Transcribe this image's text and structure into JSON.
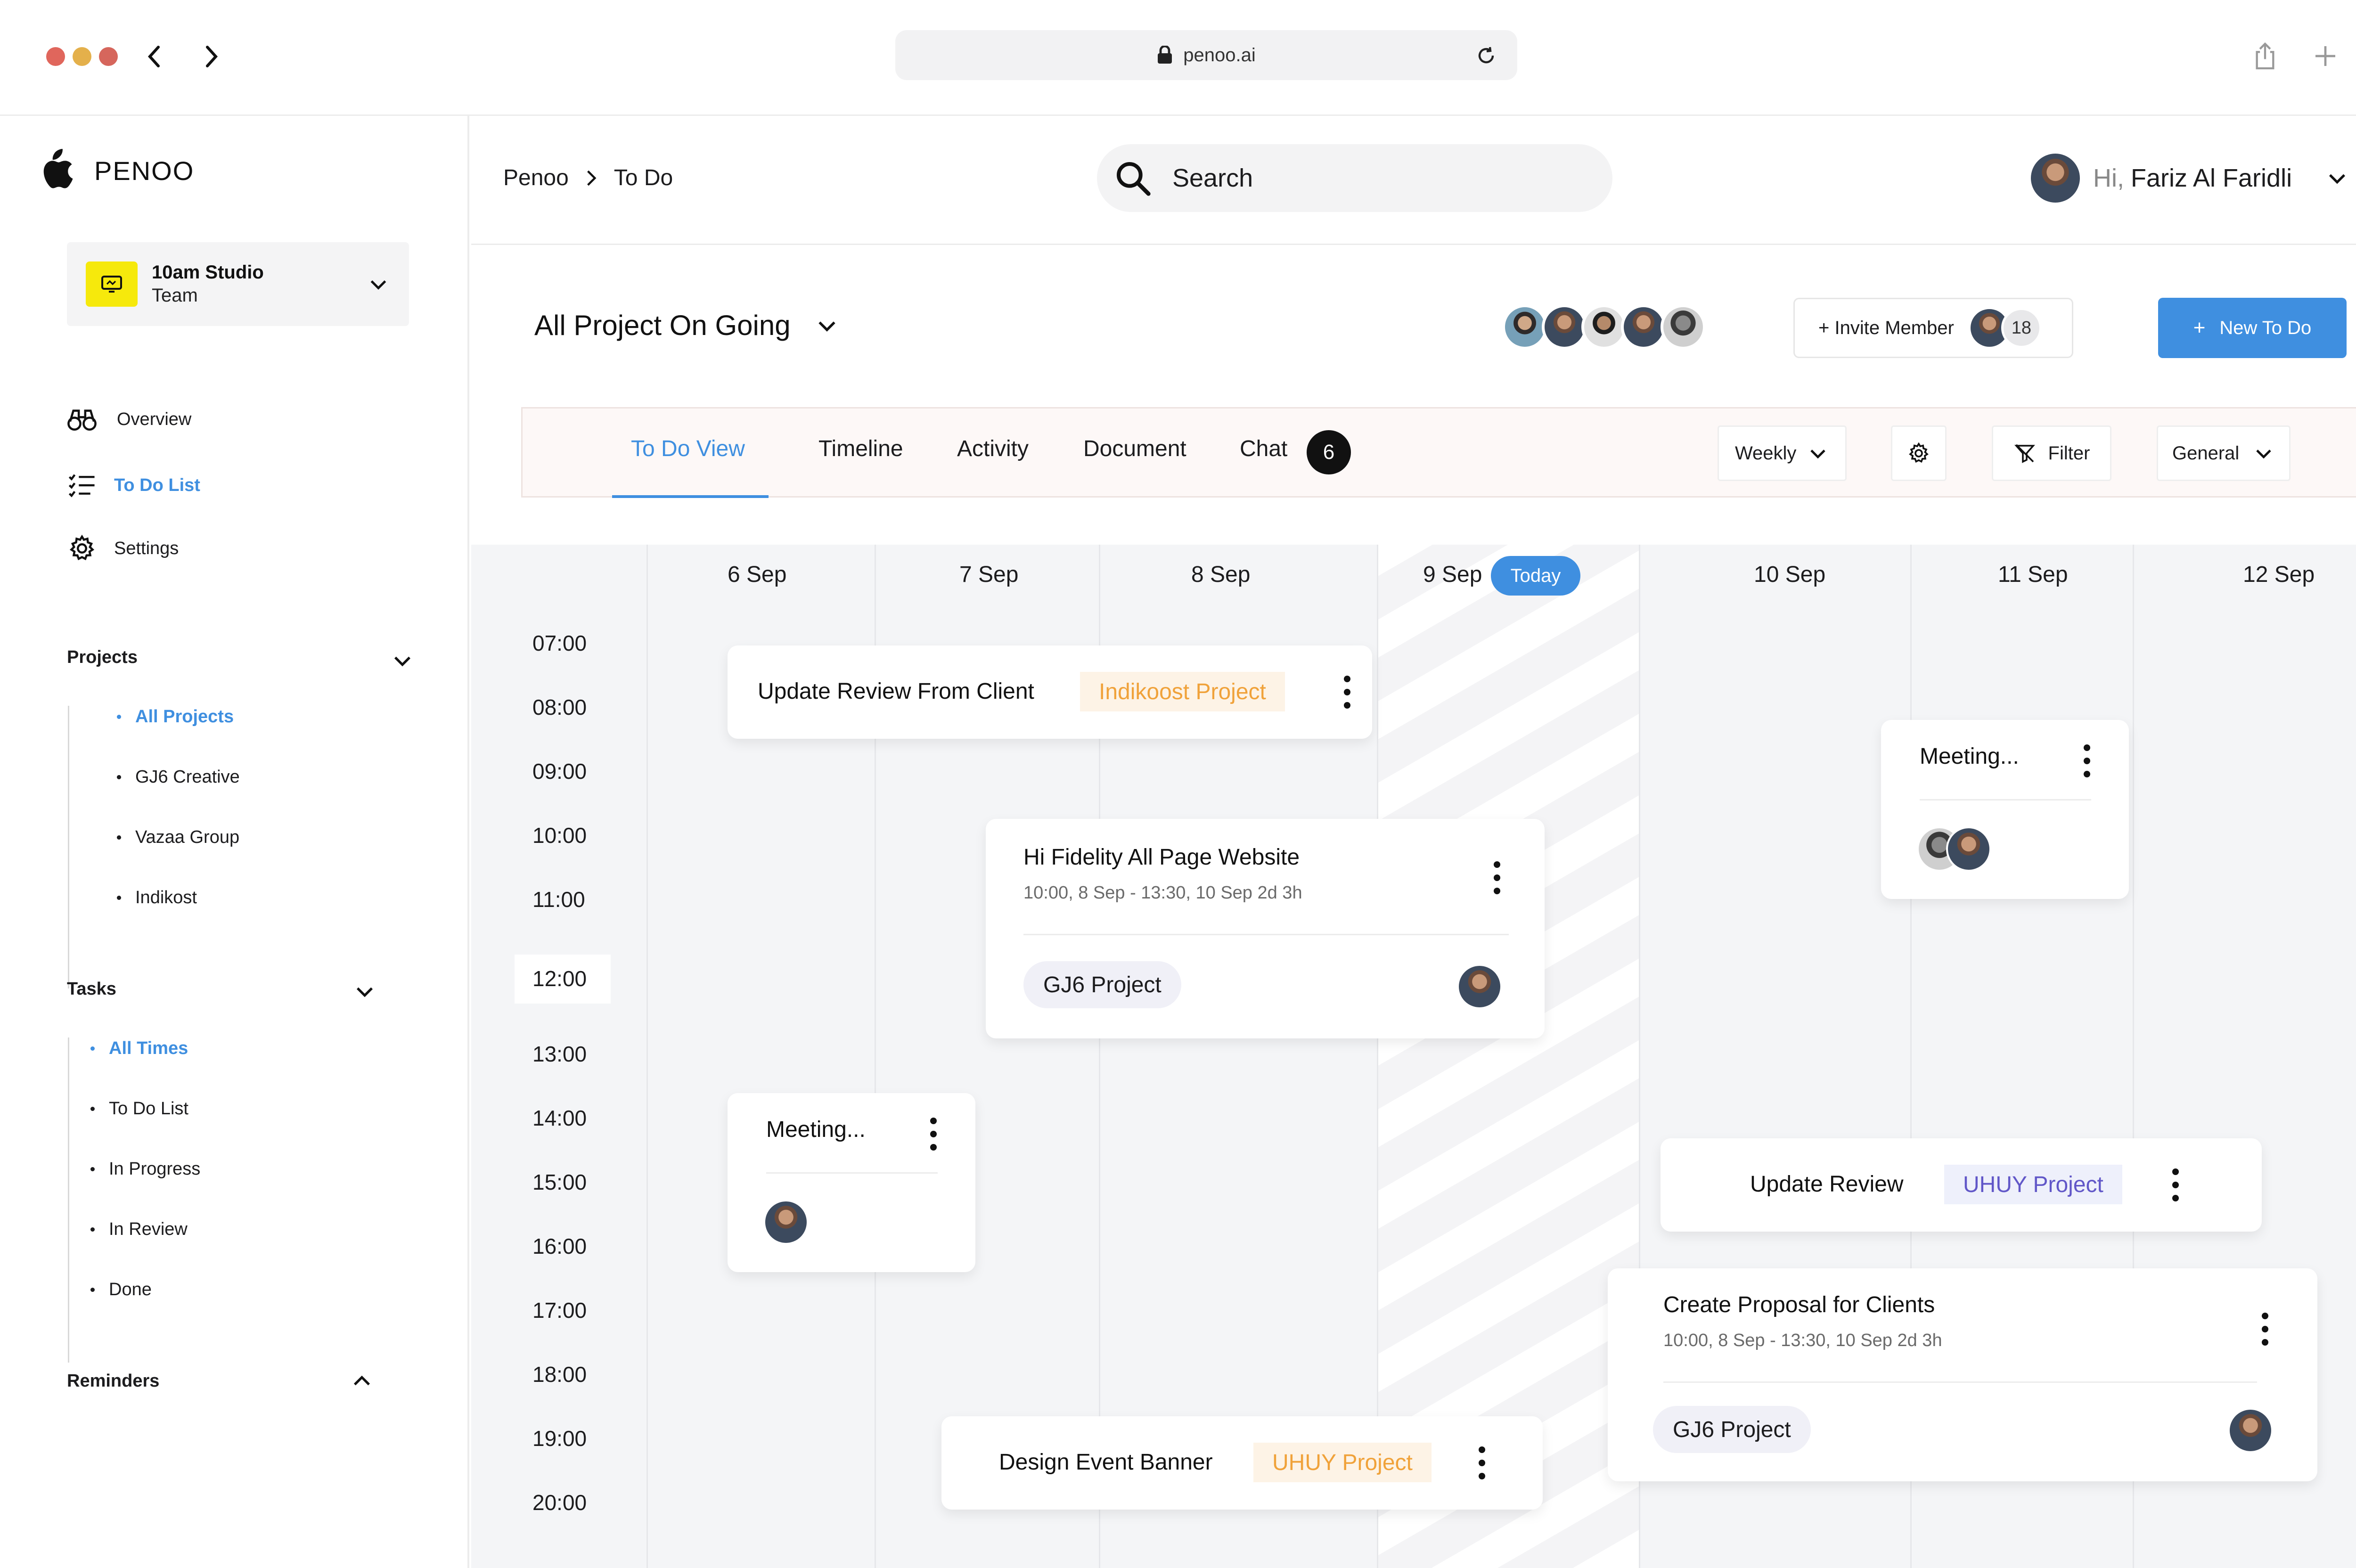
{
  "browser": {
    "url": "penoo.ai"
  },
  "brand": {
    "name": "PENOO"
  },
  "team": {
    "name": "10am Studio",
    "sub": "Team"
  },
  "sidebar": {
    "menu": [
      {
        "label": "Overview",
        "icon": "binoculars-icon"
      },
      {
        "label": "To Do List",
        "icon": "checklist-icon",
        "active": true
      },
      {
        "label": "Settings",
        "icon": "gear-icon"
      }
    ],
    "projects": {
      "title": "Projects",
      "items": [
        "All Projects",
        "GJ6 Creative",
        "Vazaa Group",
        "Indikost"
      ]
    },
    "tasks": {
      "title": "Tasks",
      "items": [
        "All Times",
        "To Do List",
        "In Progress",
        "In Review",
        "Done"
      ]
    },
    "reminders": {
      "title": "Reminders"
    }
  },
  "header": {
    "breadcrumb": [
      "Penoo",
      "To Do"
    ],
    "search_placeholder": "Search",
    "greeting": "Hi,",
    "user_name": "Fariz Al Faridli"
  },
  "project": {
    "title": "All Project On Going",
    "invite_label": "+ Invite Member",
    "member_count": "18",
    "new_label": "New To Do"
  },
  "tabs": {
    "items": [
      "To Do View",
      "Timeline",
      "Activity",
      "Document",
      "Chat"
    ],
    "chat_count": "6",
    "range": "Weekly",
    "filter": "Filter",
    "group": "General"
  },
  "calendar": {
    "days": [
      "6 Sep",
      "7 Sep",
      "8 Sep",
      "9 Sep",
      "10 Sep",
      "11 Sep",
      "12 Sep"
    ],
    "today_label": "Today",
    "times": [
      "07:00",
      "08:00",
      "09:00",
      "10:00",
      "11:00",
      "12:00",
      "13:00",
      "14:00",
      "15:00",
      "16:00",
      "17:00",
      "18:00",
      "19:00",
      "20:00"
    ],
    "events": {
      "review_client": {
        "title": "Update Review From Client",
        "tag": "Indikoost Project"
      },
      "hifi": {
        "title": "Hi Fidelity All Page Website",
        "time": "10:00, 8 Sep - 13:30, 10 Sep 2d 3h",
        "tag": "GJ6 Project"
      },
      "meeting_left": {
        "title": "Meeting..."
      },
      "meeting_right": {
        "title": "Meeting..."
      },
      "update_review": {
        "title": "Update Review",
        "tag": "UHUY  Project"
      },
      "proposal": {
        "title": "Create Proposal for Clients",
        "time": "10:00, 8 Sep - 13:30, 10 Sep 2d 3h",
        "tag": "GJ6 Project"
      },
      "banner": {
        "title": "Design Event Banner",
        "tag": "UHUY  Project"
      }
    }
  },
  "colors": {
    "accent": "#3f8fe0",
    "orange_tag": "#f0a23a",
    "purple_tag": "#6157c8",
    "team_logo": "#f6e90c"
  }
}
